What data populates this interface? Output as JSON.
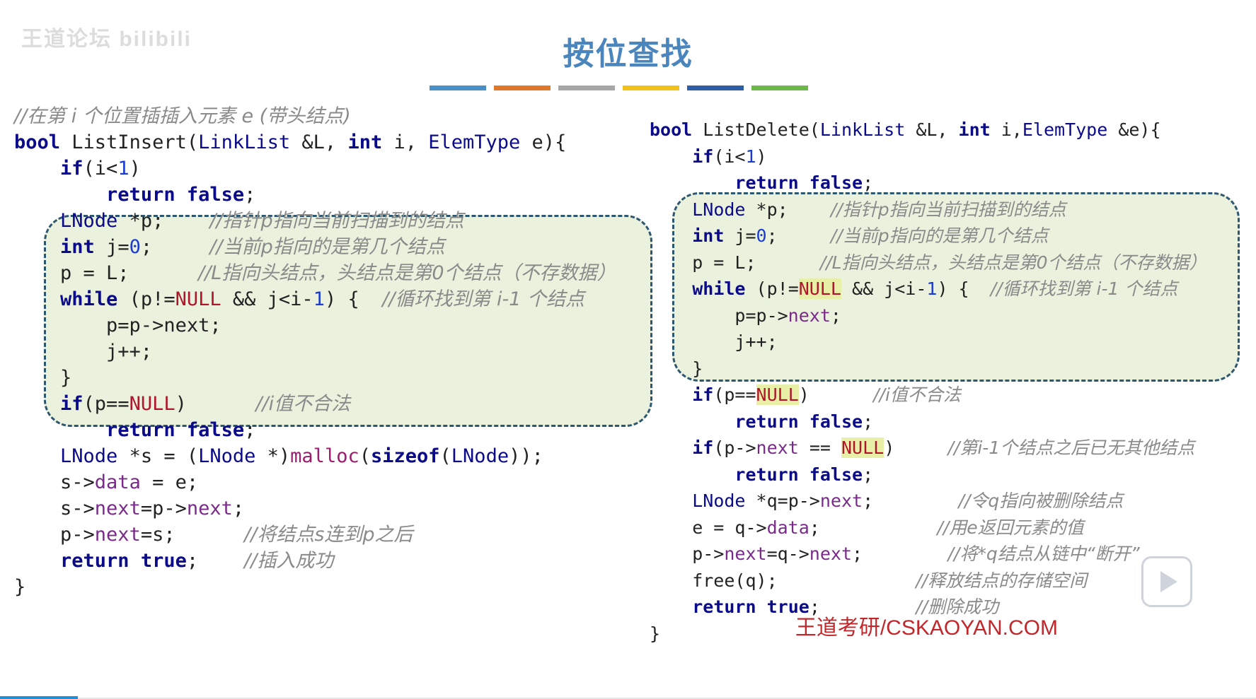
{
  "header": {
    "title": "按位查找",
    "watermark": "王道论坛 bilibili",
    "color_bar": [
      "#4a90c8",
      "#e0782a",
      "#a6a6a6",
      "#f2c21b",
      "#2e5fa6",
      "#6cb94a"
    ]
  },
  "left_code": {
    "lines": [
      [
        {
          "t": "//在第 i 个位置插插入元素 e (带头结点)",
          "c": "cm"
        }
      ],
      [
        {
          "t": "bool",
          "c": "kw"
        },
        {
          "t": " ListInsert("
        },
        {
          "t": "LinkList",
          "c": "ty"
        },
        {
          "t": " &L, "
        },
        {
          "t": "int",
          "c": "kw"
        },
        {
          "t": " i, "
        },
        {
          "t": "ElemType",
          "c": "ty"
        },
        {
          "t": " e){"
        }
      ],
      [
        {
          "t": "    "
        },
        {
          "t": "if",
          "c": "kw"
        },
        {
          "t": "(i<"
        },
        {
          "t": "1",
          "c": "num"
        },
        {
          "t": ")"
        }
      ],
      [
        {
          "t": "        "
        },
        {
          "t": "return",
          "c": "kw"
        },
        {
          "t": " "
        },
        {
          "t": "false",
          "c": "kw"
        },
        {
          "t": ";"
        }
      ],
      [
        {
          "t": "    "
        },
        {
          "t": "LNode",
          "c": "ty"
        },
        {
          "t": " *p;    "
        },
        {
          "t": "//指针p指向当前扫描到的结点",
          "c": "cm"
        }
      ],
      [
        {
          "t": "    "
        },
        {
          "t": "int",
          "c": "kw"
        },
        {
          "t": " j="
        },
        {
          "t": "0",
          "c": "num"
        },
        {
          "t": ";     "
        },
        {
          "t": "//当前p指向的是第几个结点",
          "c": "cm"
        }
      ],
      [
        {
          "t": "    p = L;      "
        },
        {
          "t": "//L指向头结点，头结点是第0个结点（不存数据）",
          "c": "cm"
        }
      ],
      [
        {
          "t": "    "
        },
        {
          "t": "while",
          "c": "kw"
        },
        {
          "t": " (p!="
        },
        {
          "t": "NULL",
          "c": "nul"
        },
        {
          "t": " && j<i-"
        },
        {
          "t": "1",
          "c": "num"
        },
        {
          "t": ") {  "
        },
        {
          "t": "//循环找到第 i-1 个结点",
          "c": "cm"
        }
      ],
      [
        {
          "t": "        p=p->next;"
        }
      ],
      [
        {
          "t": "        j++;"
        }
      ],
      [
        {
          "t": "    }"
        }
      ],
      [
        {
          "t": "    "
        },
        {
          "t": "if",
          "c": "kw"
        },
        {
          "t": "(p=="
        },
        {
          "t": "NULL",
          "c": "nul"
        },
        {
          "t": ")      "
        },
        {
          "t": "//i值不合法",
          "c": "cm"
        }
      ],
      [
        {
          "t": "        "
        },
        {
          "t": "return",
          "c": "kw"
        },
        {
          "t": " "
        },
        {
          "t": "false",
          "c": "kw"
        },
        {
          "t": ";"
        }
      ],
      [
        {
          "t": "    "
        },
        {
          "t": "LNode",
          "c": "ty"
        },
        {
          "t": " *s = ("
        },
        {
          "t": "LNode",
          "c": "ty"
        },
        {
          "t": " *)"
        },
        {
          "t": "malloc",
          "c": "fn"
        },
        {
          "t": "("
        },
        {
          "t": "sizeof",
          "c": "kw"
        },
        {
          "t": "("
        },
        {
          "t": "LNode",
          "c": "ty"
        },
        {
          "t": "));"
        }
      ],
      [
        {
          "t": "    s->"
        },
        {
          "t": "data",
          "c": "fld"
        },
        {
          "t": " = e;"
        }
      ],
      [
        {
          "t": "    s->"
        },
        {
          "t": "next",
          "c": "fld"
        },
        {
          "t": "=p->"
        },
        {
          "t": "next",
          "c": "fld"
        },
        {
          "t": ";"
        }
      ],
      [
        {
          "t": "    p->"
        },
        {
          "t": "next",
          "c": "fld"
        },
        {
          "t": "=s;      "
        },
        {
          "t": "//将结点s连到p之后",
          "c": "cm"
        }
      ],
      [
        {
          "t": "    "
        },
        {
          "t": "return",
          "c": "kw"
        },
        {
          "t": " "
        },
        {
          "t": "true",
          "c": "kw"
        },
        {
          "t": ";    "
        },
        {
          "t": "//插入成功",
          "c": "cm"
        }
      ],
      [
        {
          "t": "}"
        }
      ]
    ]
  },
  "right_code": {
    "lines": [
      [
        {
          "t": "bool",
          "c": "kw"
        },
        {
          "t": " ListDelete("
        },
        {
          "t": "LinkList",
          "c": "ty"
        },
        {
          "t": " &L, "
        },
        {
          "t": "int",
          "c": "kw"
        },
        {
          "t": " i,"
        },
        {
          "t": "ElemType",
          "c": "ty"
        },
        {
          "t": " &e){"
        }
      ],
      [
        {
          "t": "    "
        },
        {
          "t": "if",
          "c": "kw"
        },
        {
          "t": "(i<"
        },
        {
          "t": "1",
          "c": "num"
        },
        {
          "t": ")"
        }
      ],
      [
        {
          "t": "        "
        },
        {
          "t": "return",
          "c": "kw"
        },
        {
          "t": " "
        },
        {
          "t": "false",
          "c": "kw"
        },
        {
          "t": ";"
        }
      ],
      [
        {
          "t": "    "
        },
        {
          "t": "LNode",
          "c": "ty"
        },
        {
          "t": " *p;    "
        },
        {
          "t": "//指针p指向当前扫描到的结点",
          "c": "cm"
        }
      ],
      [
        {
          "t": "    "
        },
        {
          "t": "int",
          "c": "kw"
        },
        {
          "t": " j="
        },
        {
          "t": "0",
          "c": "num"
        },
        {
          "t": ";     "
        },
        {
          "t": "//当前p指向的是第几个结点",
          "c": "cm"
        }
      ],
      [
        {
          "t": "    p = L;      "
        },
        {
          "t": "//L指向头结点，头结点是第0个结点（不存数据）",
          "c": "cm"
        }
      ],
      [
        {
          "t": "    "
        },
        {
          "t": "while",
          "c": "kw"
        },
        {
          "t": " (p!="
        },
        {
          "t": "NULL",
          "c": "nulh"
        },
        {
          "t": " && j<i-"
        },
        {
          "t": "1",
          "c": "num"
        },
        {
          "t": ") {  "
        },
        {
          "t": "//循环找到第 i-1 个结点",
          "c": "cm"
        }
      ],
      [
        {
          "t": "        p=p->"
        },
        {
          "t": "next",
          "c": "fld"
        },
        {
          "t": ";"
        }
      ],
      [
        {
          "t": "        j++;"
        }
      ],
      [
        {
          "t": "    }"
        }
      ],
      [
        {
          "t": "    "
        },
        {
          "t": "if",
          "c": "kw"
        },
        {
          "t": "(p=="
        },
        {
          "t": "NULL",
          "c": "nulh"
        },
        {
          "t": ")      "
        },
        {
          "t": "//i值不合法",
          "c": "cm"
        }
      ],
      [
        {
          "t": "        "
        },
        {
          "t": "return",
          "c": "kw"
        },
        {
          "t": " "
        },
        {
          "t": "false",
          "c": "kw"
        },
        {
          "t": ";"
        }
      ],
      [
        {
          "t": "    "
        },
        {
          "t": "if",
          "c": "kw"
        },
        {
          "t": "(p->"
        },
        {
          "t": "next",
          "c": "fld"
        },
        {
          "t": " == "
        },
        {
          "t": "NULL",
          "c": "nulh"
        },
        {
          "t": ")     "
        },
        {
          "t": "//第i-1个结点之后已无其他结点",
          "c": "cm"
        }
      ],
      [
        {
          "t": "        "
        },
        {
          "t": "return",
          "c": "kw"
        },
        {
          "t": " "
        },
        {
          "t": "false",
          "c": "kw"
        },
        {
          "t": ";"
        }
      ],
      [
        {
          "t": "    "
        },
        {
          "t": "LNode",
          "c": "ty"
        },
        {
          "t": " *q=p->"
        },
        {
          "t": "next",
          "c": "fld"
        },
        {
          "t": ";        "
        },
        {
          "t": "//令q指向被删除结点",
          "c": "cm"
        }
      ],
      [
        {
          "t": "    e = q->"
        },
        {
          "t": "data",
          "c": "fld"
        },
        {
          "t": ";           "
        },
        {
          "t": "//用e返回元素的值",
          "c": "cm"
        }
      ],
      [
        {
          "t": "    p->"
        },
        {
          "t": "next",
          "c": "fld"
        },
        {
          "t": "=q->"
        },
        {
          "t": "next",
          "c": "fld"
        },
        {
          "t": ";        "
        },
        {
          "t": "//将*q结点从链中“断开”",
          "c": "cm"
        }
      ],
      [
        {
          "t": "    free(q);             "
        },
        {
          "t": "//释放结点的存储空间",
          "c": "cm"
        }
      ],
      [
        {
          "t": "    "
        },
        {
          "t": "return",
          "c": "kw"
        },
        {
          "t": " "
        },
        {
          "t": "true",
          "c": "kw"
        },
        {
          "t": ";         "
        },
        {
          "t": "//删除成功",
          "c": "cm"
        }
      ],
      [
        {
          "t": "}"
        }
      ]
    ]
  },
  "footer": {
    "brand": "王道考研/CSKAOYAN.COM"
  }
}
